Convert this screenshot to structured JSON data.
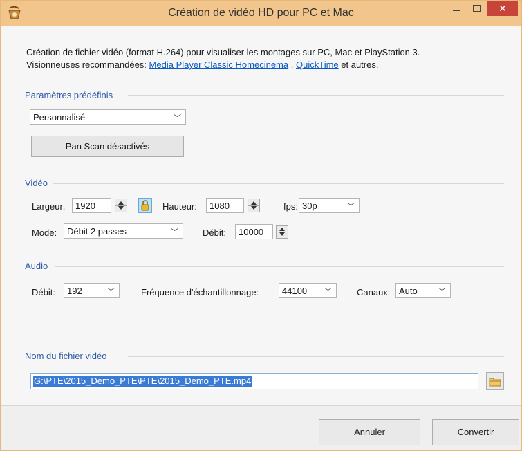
{
  "window": {
    "title": "Création de vidéo HD pour PC et Mac",
    "close_glyph": "✕"
  },
  "intro": {
    "line1": "Création de fichier vidéo (format H.264) pour visualiser les montages sur PC, Mac et PlayStation 3.",
    "line2_prefix": "Visionneuses recommandées:",
    "link1": "Media Player Classic Homecinema",
    "separator": ",",
    "link2": "QuickTime",
    "line2_suffix": "et autres."
  },
  "presets": {
    "section_title": "Paramètres prédéfinis",
    "preset_value": "Personnalisé",
    "panscan_label": "Pan  Scan désactivés"
  },
  "video": {
    "section_title": "Vidéo",
    "width_label": "Largeur:",
    "width_value": "1920",
    "height_label": "Hauteur:",
    "height_value": "1080",
    "fps_label": "fps:",
    "fps_value": "30p",
    "mode_label": "Mode:",
    "mode_value": "Débit 2 passes",
    "bitrate_label": "Débit:",
    "bitrate_value": "10000"
  },
  "audio": {
    "section_title": "Audio",
    "bitrate_label": "Débit:",
    "bitrate_value": "192",
    "samplerate_label": "Fréquence d'échantillonnage:",
    "samplerate_value": "44100",
    "channels_label": "Canaux:",
    "channels_value": "Auto"
  },
  "file": {
    "section_title": "Nom du fichier vidéo",
    "path": "G:\\PTE\\2015_Demo_PTE\\PTE\\2015_Demo_PTE.mp4"
  },
  "actions": {
    "cancel_label": "Annuler",
    "convert_label": "Convertir"
  },
  "icons": {
    "app": "app-logo-icon",
    "lock": "lock-icon",
    "folder": "folder-icon",
    "dropdown": "chevron-down-icon"
  },
  "colors": {
    "titlebar": "#f1c58c",
    "close": "#c7443a",
    "section_title": "#2f5aa8",
    "link": "#0b5bc5",
    "selection": "#3a7bd5"
  }
}
